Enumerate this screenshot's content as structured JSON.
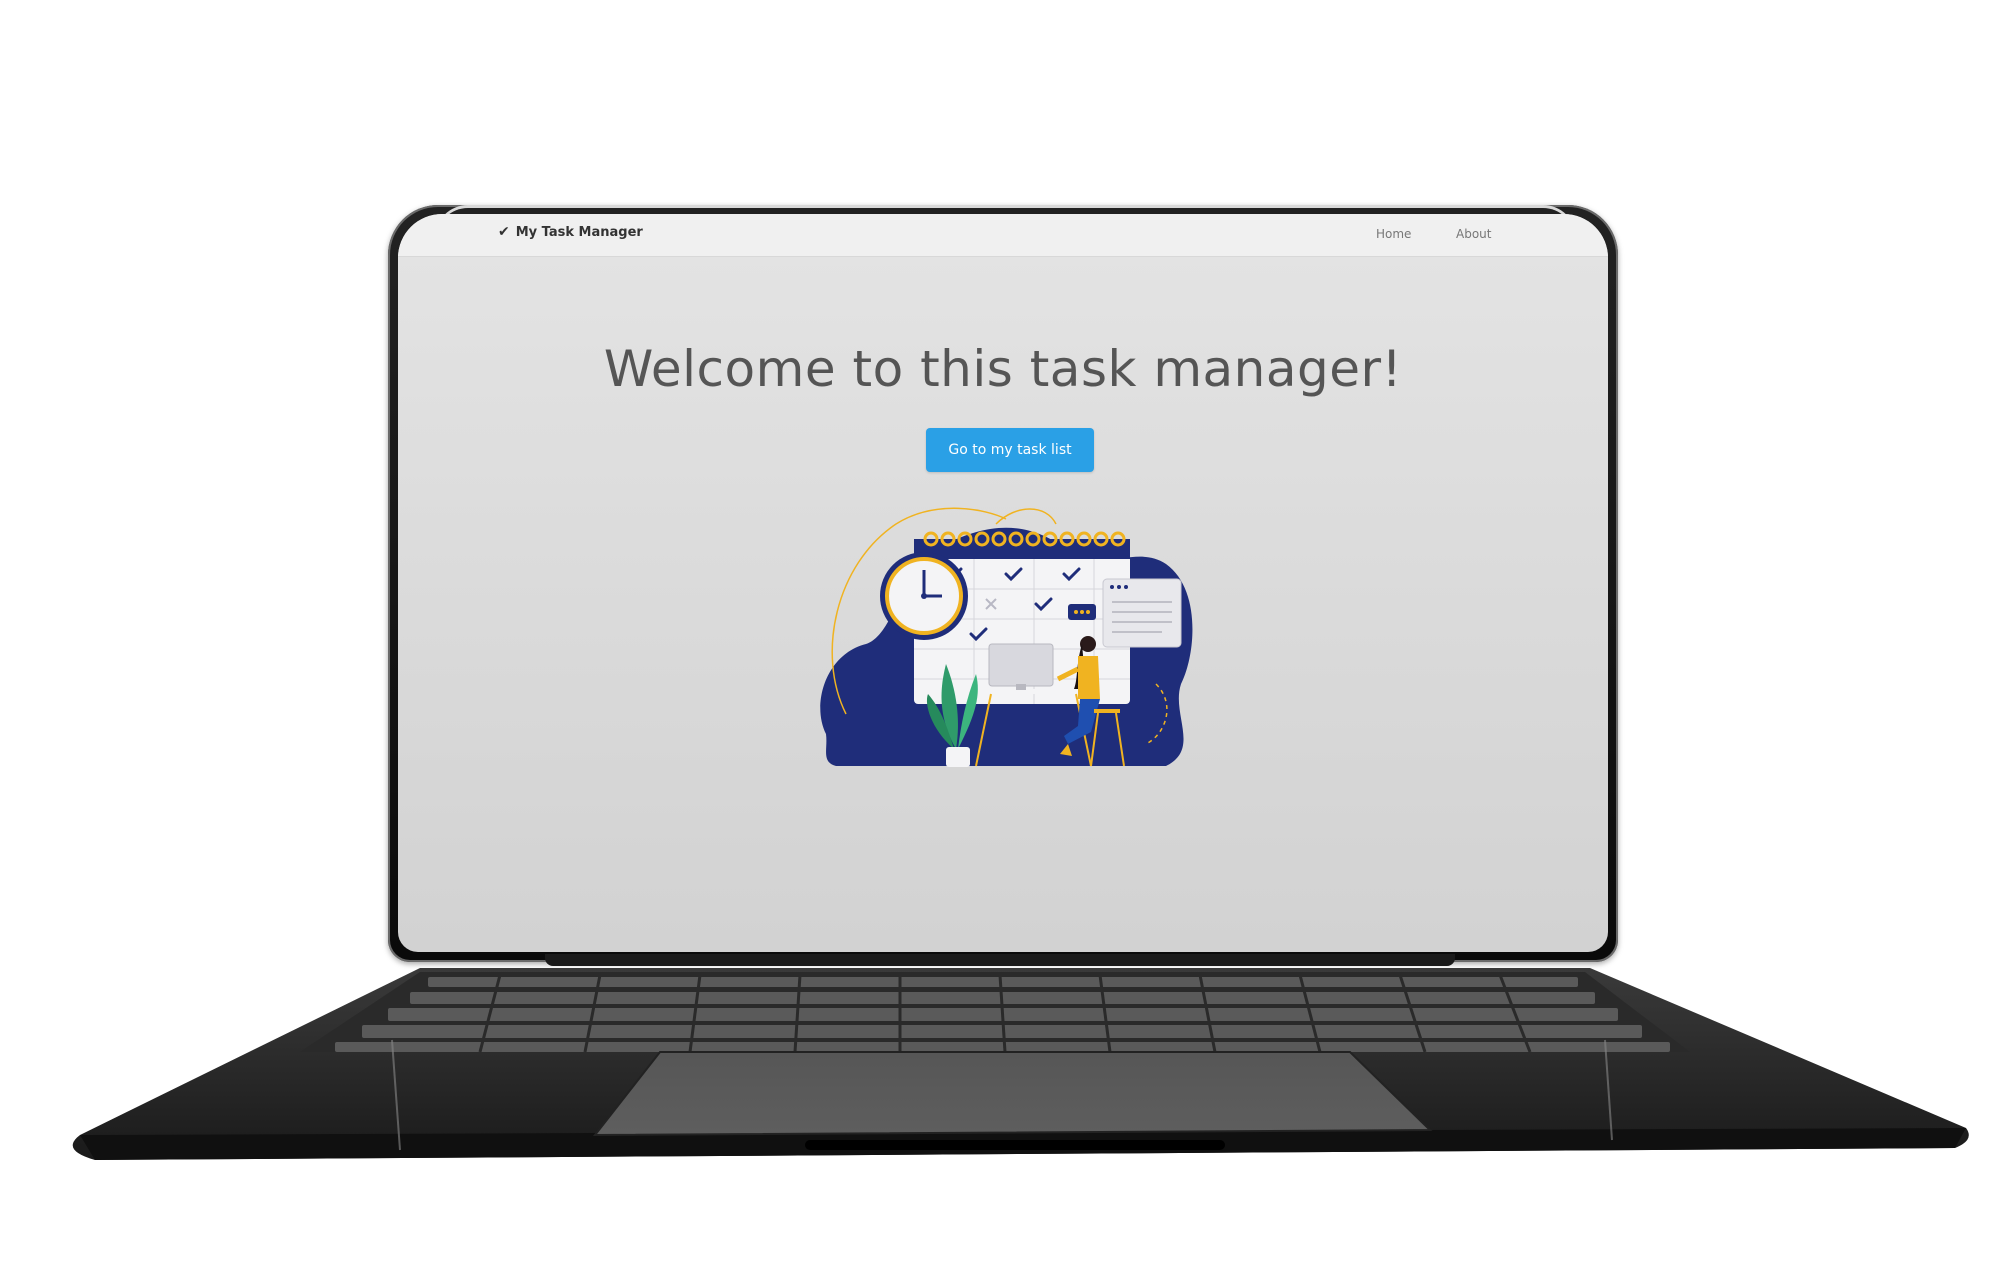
{
  "app": {
    "brand_name": "My Task Manager",
    "brand_icon": "check-icon"
  },
  "nav": {
    "items": [
      {
        "label": "Home"
      },
      {
        "label": "About"
      }
    ]
  },
  "hero": {
    "title": "Welcome to this task manager!",
    "cta_label": "Go to my task list",
    "cta_color": "#2aa0e6"
  },
  "illustration": {
    "subject": "person-at-desk-with-calendar-and-clock",
    "colors": {
      "navy": "#1f2d7a",
      "gold": "#f0b321",
      "white": "#ffffff",
      "plant": "#2f9b6a"
    }
  },
  "device": {
    "type": "laptop"
  }
}
